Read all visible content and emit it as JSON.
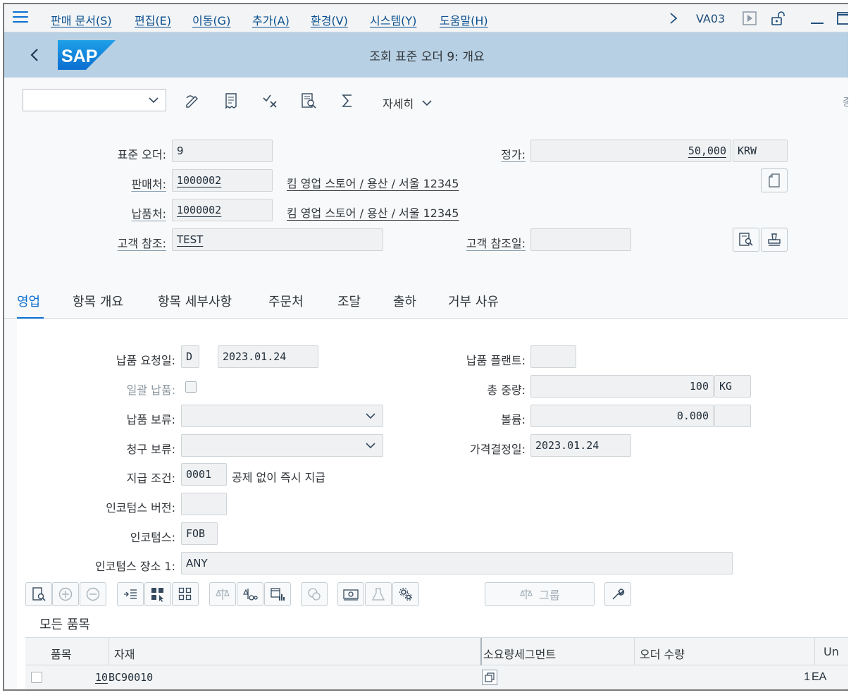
{
  "menu": {
    "items": [
      "판매 문서(S)",
      "편집(E)",
      "이동(G)",
      "추가(A)",
      "환경(V)",
      "시스템(Y)",
      "도움말(H)"
    ],
    "tcode": "VA03"
  },
  "header": {
    "logo": "SAP",
    "title": "조회 표준 오더 9: 개요"
  },
  "toolbar": {
    "detail_label": "자세히",
    "edge_text": "종"
  },
  "order": {
    "std_order_label": "표준 오더:",
    "std_order_value": "9",
    "net_price_label": "정가:",
    "net_price_value": "50,000",
    "currency": "KRW",
    "sold_to_label": "판매처:",
    "sold_to_value": "1000002",
    "sold_to_desc": "킴 영업 스토어 / 용산 / 서울 12345",
    "ship_to_label": "납품처:",
    "ship_to_value": "1000002",
    "ship_to_desc": "킴 영업 스토어 / 용산 / 서울 12345",
    "cust_ref_label": "고객 참조:",
    "cust_ref_value": "TEST",
    "cust_ref_date_label": "고객 참조일:",
    "cust_ref_date_value": ""
  },
  "tabs": [
    {
      "label": "영업",
      "active": true
    },
    {
      "label": "항목 개요"
    },
    {
      "label": "항목 세부사항"
    },
    {
      "label": "주문처"
    },
    {
      "label": "조달"
    },
    {
      "label": "출하"
    },
    {
      "label": "거부 사유"
    }
  ],
  "sales": {
    "req_deliv_label": "납품 요청일:",
    "req_deliv_type": "D",
    "req_deliv_date": "2023.01.24",
    "deliv_plant_label": "납품 플랜트:",
    "deliv_plant_value": "",
    "complete_deliv_label": "일괄 납품:",
    "total_weight_label": "총 중량:",
    "total_weight_value": "100",
    "weight_unit": "KG",
    "deliv_block_label": "납품 보류:",
    "volume_label": "볼륨:",
    "volume_value": "0.000",
    "volume_unit": "",
    "billing_block_label": "청구 보류:",
    "pricing_date_label": "가격결정일:",
    "pricing_date_value": "2023.01.24",
    "payment_terms_label": "지급 조건:",
    "payment_terms_value": "0001",
    "payment_terms_desc": "공제 없이 즉시 지급",
    "incoterms_version_label": "인코텀스 버전:",
    "incoterms_version_value": "",
    "incoterms_label": "인코텀스:",
    "incoterms_value": "FOB",
    "incoterms_loc_label": "인코텀스 장소 1:",
    "incoterms_loc_value": "ANY"
  },
  "items_toolbar": {
    "group_label": "그룹"
  },
  "items": {
    "section_title": "모든 품목",
    "columns": [
      "품목",
      "자재",
      "소요량세그먼트",
      "오더 수량",
      "Un"
    ],
    "rows": [
      {
        "item": "10",
        "material": "BC90010",
        "segment": "",
        "qty": "1",
        "unit": "EA"
      }
    ]
  }
}
